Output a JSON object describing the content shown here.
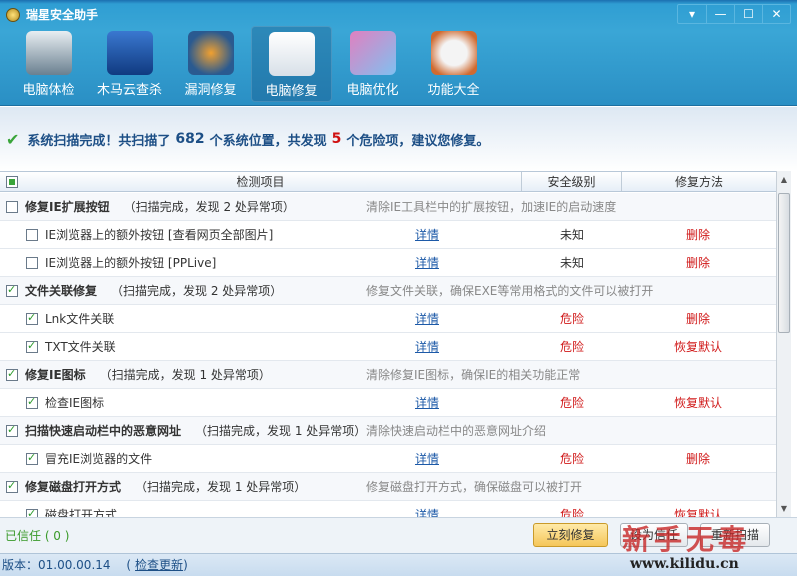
{
  "app": {
    "title": "瑞星安全助手",
    "window_buttons": [
      "▾",
      "—",
      "☐",
      "✕"
    ]
  },
  "toolbar": [
    {
      "label": "电脑体检",
      "icon": "monitor-pulse-icon",
      "active": false
    },
    {
      "label": "木马云查杀",
      "icon": "shield-horse-icon",
      "active": false
    },
    {
      "label": "漏洞修复",
      "icon": "windows-refresh-icon",
      "active": false
    },
    {
      "label": "电脑修复",
      "icon": "checklist-icon",
      "active": true
    },
    {
      "label": "电脑优化",
      "icon": "monitor-wand-icon",
      "active": false
    },
    {
      "label": "功能大全",
      "icon": "disc-box-icon",
      "active": false
    }
  ],
  "banner": {
    "part1": "系统扫描完成！共扫描了",
    "scanned": "682",
    "part2": "个系统位置，共发现",
    "found": "5",
    "part3": "个危险项，建议您修复。"
  },
  "table": {
    "headers": [
      "检测项目",
      "安全级别",
      "修复方法"
    ],
    "rows": [
      {
        "type": "group",
        "checked": false,
        "name": "修复IE扩展按钮",
        "status": "（扫描完成，发现 2 处异常项）",
        "desc": "清除IE工具栏中的扩展按钮，加速IE的启动速度"
      },
      {
        "type": "child",
        "checked": false,
        "name": "IE浏览器上的额外按钮 [查看网页全部图片]",
        "detail": "详情",
        "level": "未知",
        "fix": "删除"
      },
      {
        "type": "child",
        "checked": false,
        "name": "IE浏览器上的额外按钮 [PPLive]",
        "detail": "详情",
        "level": "未知",
        "fix": "删除"
      },
      {
        "type": "group",
        "checked": true,
        "name": "文件关联修复",
        "status": "（扫描完成，发现 2 处异常项）",
        "desc": "修复文件关联，确保EXE等常用格式的文件可以被打开"
      },
      {
        "type": "child",
        "checked": true,
        "name": "Lnk文件关联",
        "detail": "详情",
        "level": "危险",
        "fix": "删除"
      },
      {
        "type": "child",
        "checked": true,
        "name": "TXT文件关联",
        "detail": "详情",
        "level": "危险",
        "fix": "恢复默认"
      },
      {
        "type": "group",
        "checked": true,
        "name": "修复IE图标",
        "status": "（扫描完成，发现 1 处异常项）",
        "desc": "清除修复IE图标，确保IE的相关功能正常"
      },
      {
        "type": "child",
        "checked": true,
        "name": "检查IE图标",
        "detail": "详情",
        "level": "危险",
        "fix": "恢复默认"
      },
      {
        "type": "group",
        "checked": true,
        "name": "扫描快速启动栏中的恶意网址",
        "status": "（扫描完成，发现 1 处异常项）",
        "desc": "清除快速启动栏中的恶意网址介绍"
      },
      {
        "type": "child",
        "checked": true,
        "name": "冒充IE浏览器的文件",
        "detail": "详情",
        "level": "危险",
        "fix": "删除"
      },
      {
        "type": "group",
        "checked": true,
        "name": "修复磁盘打开方式",
        "status": "（扫描完成，发现 1 处异常项）",
        "desc": "修复磁盘打开方式，确保磁盘可以被打开"
      },
      {
        "type": "child",
        "checked": true,
        "name": "磁盘打开方式",
        "detail": "详情",
        "level": "危险",
        "fix": "恢复默认"
      }
    ]
  },
  "footer": {
    "trusted": "已信任 ( 0 )",
    "fix_now": "立刻修复",
    "trust": "设为信任",
    "rescan": "重新扫描"
  },
  "version": {
    "label": "版本：01.00.00.14",
    "update_link": "检查更新"
  },
  "watermark": {
    "text": "新手无毒",
    "url": "www.kilidu.cn"
  },
  "colors": {
    "accent": "#2a8fc4",
    "danger": "#d01818",
    "link": "#1d5aa8"
  }
}
